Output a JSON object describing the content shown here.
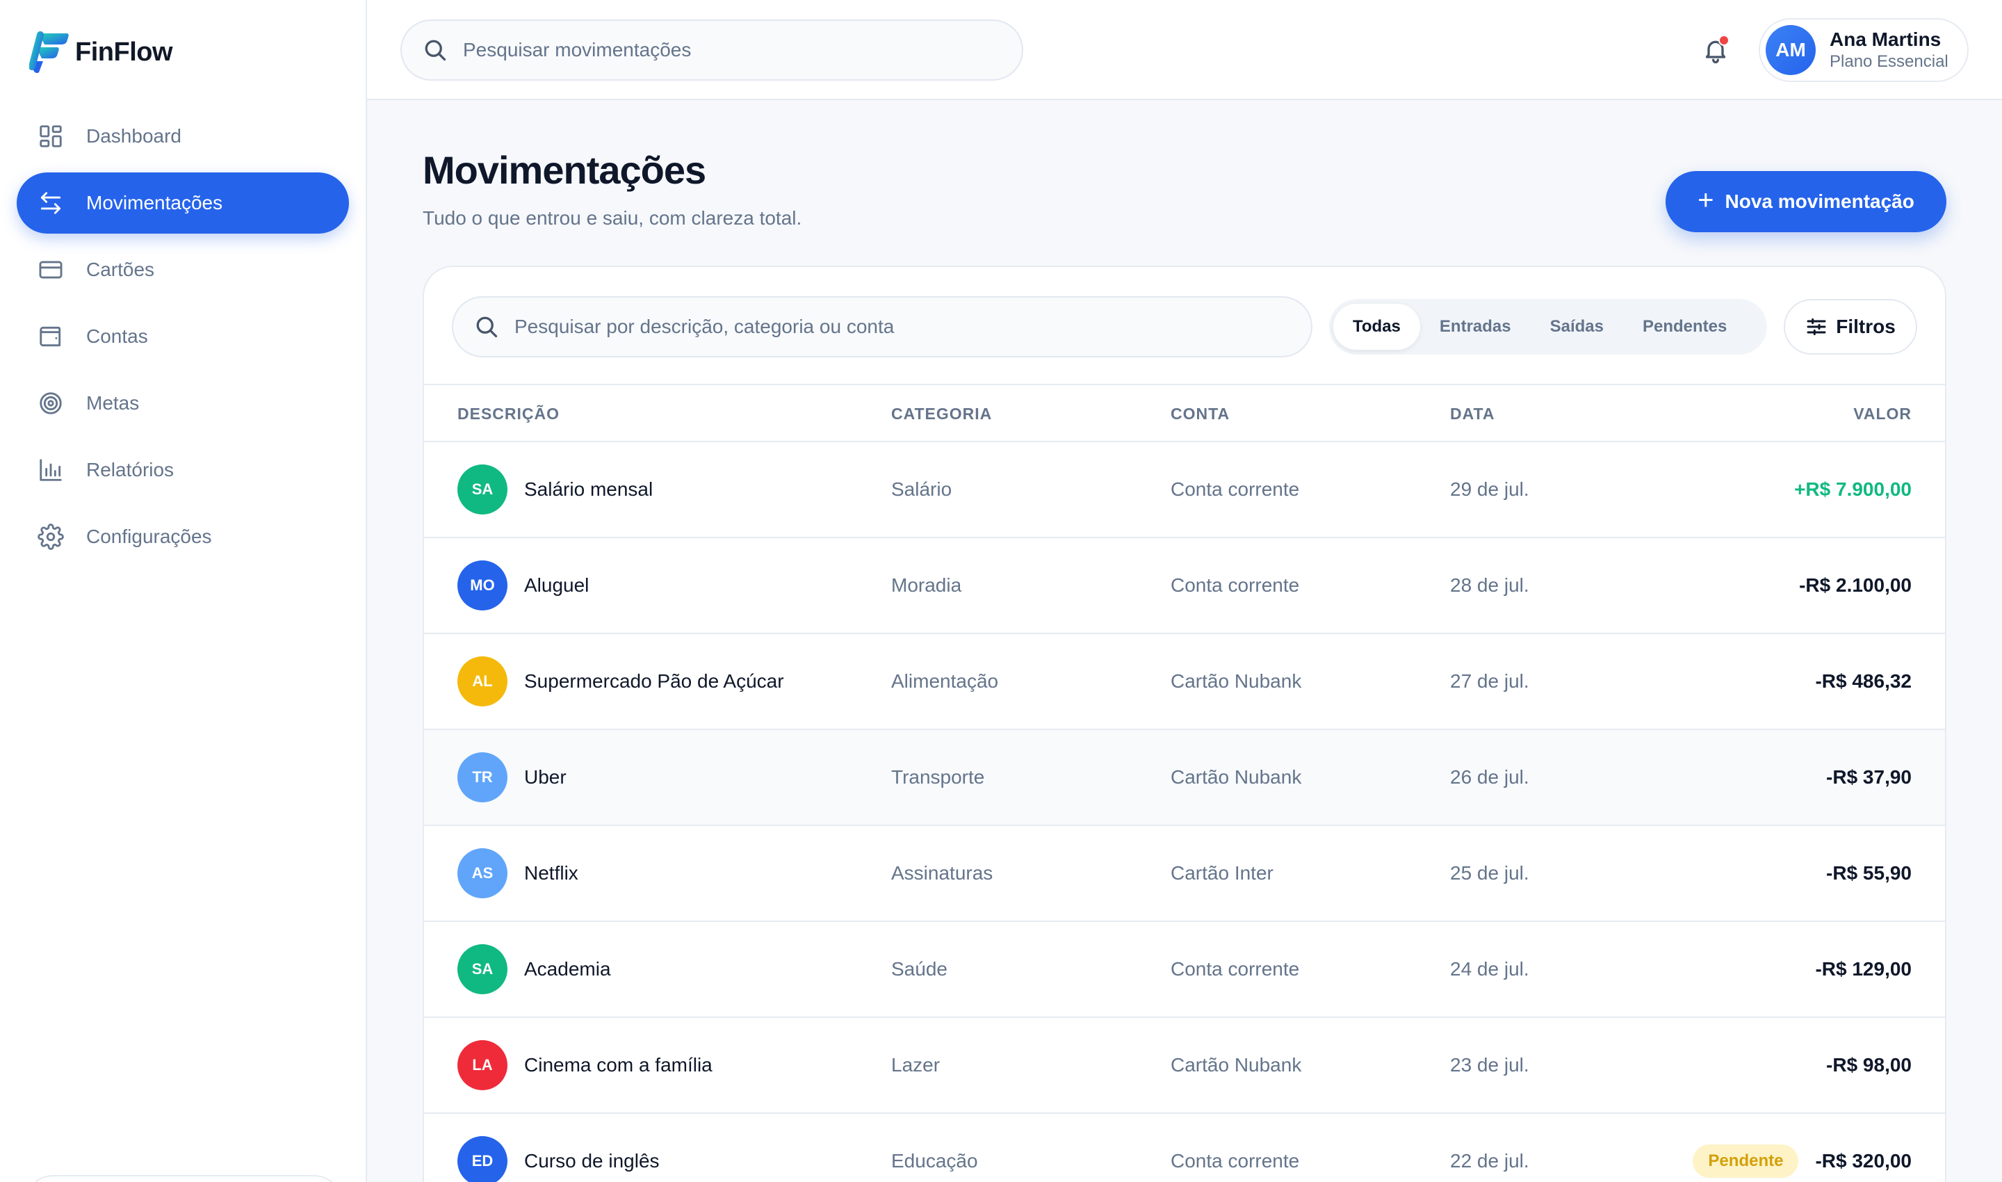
{
  "app": {
    "name": "FinFlow",
    "brand_color": "#2563eb"
  },
  "sidebar": {
    "items": [
      {
        "label": "Dashboard",
        "icon": "dashboard-icon"
      },
      {
        "label": "Movimentações",
        "icon": "arrows-swap-icon",
        "active": true
      },
      {
        "label": "Cartões",
        "icon": "credit-card-icon"
      },
      {
        "label": "Contas",
        "icon": "wallet-icon"
      },
      {
        "label": "Metas",
        "icon": "target-icon"
      },
      {
        "label": "Relatórios",
        "icon": "bar-chart-icon"
      },
      {
        "label": "Configurações",
        "icon": "gear-icon"
      }
    ]
  },
  "header": {
    "search_placeholder": "Pesquisar movimentações",
    "notifications_unread": true,
    "user": {
      "initials": "AM",
      "name": "Ana Martins",
      "plan": "Plano Essencial"
    }
  },
  "page": {
    "title": "Movimentações",
    "subtitle": "Tudo o que entrou e saiu, com clareza total.",
    "new_button": "Nova movimentação"
  },
  "toolbar": {
    "search_placeholder": "Pesquisar por descrição, categoria ou conta",
    "segments": [
      "Todas",
      "Entradas",
      "Saídas",
      "Pendentes"
    ],
    "active_segment": "Todas",
    "filter_label": "Filtros"
  },
  "table": {
    "columns": [
      "DESCRIÇÃO",
      "CATEGORIA",
      "CONTA",
      "DATA",
      "VALOR"
    ],
    "rows": [
      {
        "initials": "SA",
        "color": "#10b981",
        "description": "Salário mensal",
        "category": "Salário",
        "account": "Conta corrente",
        "date": "29 de jul.",
        "value": "+R$ 7.900,00",
        "positive": true,
        "status": ""
      },
      {
        "initials": "MO",
        "color": "#2563eb",
        "description": "Aluguel",
        "category": "Moradia",
        "account": "Conta corrente",
        "date": "28 de jul.",
        "value": "-R$ 2.100,00",
        "positive": false,
        "status": ""
      },
      {
        "initials": "AL",
        "color": "#f5b90b",
        "description": "Supermercado Pão de Açúcar",
        "category": "Alimentação",
        "account": "Cartão Nubank",
        "date": "27 de jul.",
        "value": "-R$ 486,32",
        "positive": false,
        "status": ""
      },
      {
        "initials": "TR",
        "color": "#60a5fa",
        "description": "Uber",
        "category": "Transporte",
        "account": "Cartão Nubank",
        "date": "26 de jul.",
        "value": "-R$ 37,90",
        "positive": false,
        "status": ""
      },
      {
        "initials": "AS",
        "color": "#60a5fa",
        "description": "Netflix",
        "category": "Assinaturas",
        "account": "Cartão Inter",
        "date": "25 de jul.",
        "value": "-R$ 55,90",
        "positive": false,
        "status": ""
      },
      {
        "initials": "SA",
        "color": "#10b981",
        "description": "Academia",
        "category": "Saúde",
        "account": "Conta corrente",
        "date": "24 de jul.",
        "value": "-R$ 129,00",
        "positive": false,
        "status": ""
      },
      {
        "initials": "LA",
        "color": "#ef2b3a",
        "description": "Cinema com a família",
        "category": "Lazer",
        "account": "Cartão Nubank",
        "date": "23 de jul.",
        "value": "-R$ 98,00",
        "positive": false,
        "status": ""
      },
      {
        "initials": "ED",
        "color": "#2563eb",
        "description": "Curso de inglês",
        "category": "Educação",
        "account": "Conta corrente",
        "date": "22 de jul.",
        "value": "-R$ 320,00",
        "positive": false,
        "status": "Pendente"
      }
    ]
  }
}
